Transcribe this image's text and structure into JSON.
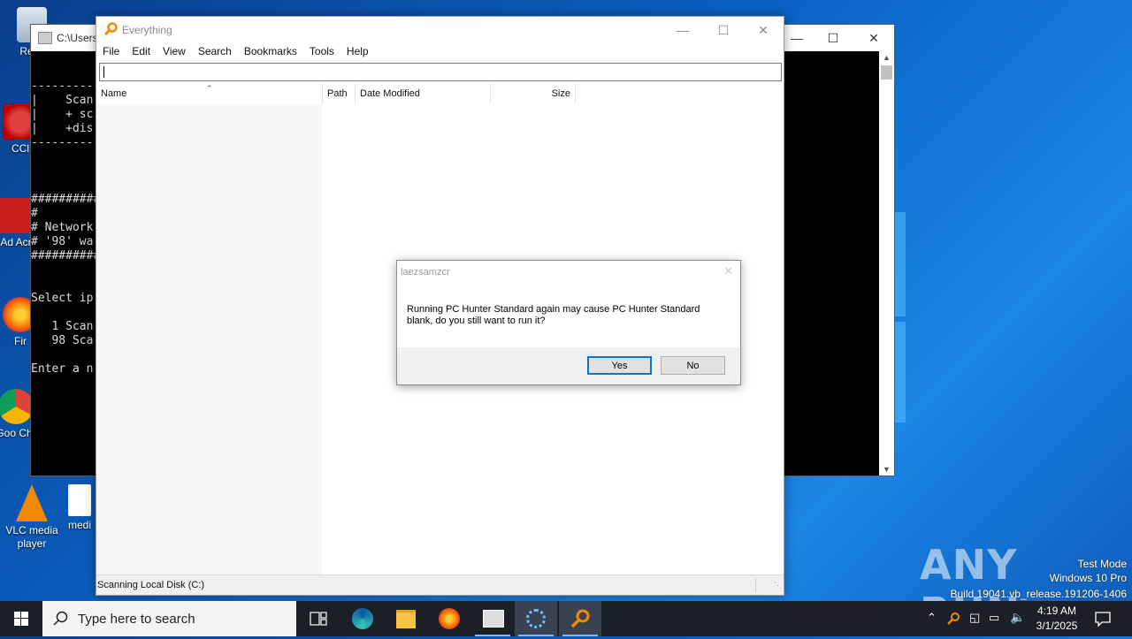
{
  "desktop": {
    "icons": [
      {
        "label": "Recy"
      },
      {
        "label": "CCl"
      },
      {
        "label": "Ad Acr"
      },
      {
        "label": "Fir"
      },
      {
        "label": "Goo Chr"
      },
      {
        "label": "VLC media player"
      },
      {
        "label": "medi"
      }
    ]
  },
  "console": {
    "title": "C:\\Users",
    "lines": [
      "",
      "",
      "----------",
      "|    Scan",
      "|    + sc",
      "|    +dis",
      "----------",
      "",
      "",
      "",
      "##########",
      "#",
      "# Network",
      "# '98' wa",
      "##########",
      "",
      "",
      "Select ip",
      "",
      "   1 Scan",
      "   98 Sca",
      "",
      "Enter a n"
    ]
  },
  "everything": {
    "title": "Everything",
    "menu": [
      "File",
      "Edit",
      "View",
      "Search",
      "Bookmarks",
      "Tools",
      "Help"
    ],
    "search_value": "",
    "columns": [
      "Name",
      "Path",
      "Date Modified",
      "Size"
    ],
    "status": "Scanning Local Disk (C:)"
  },
  "dialog": {
    "title": "laezsamzcr",
    "message": "Running PC Hunter Standard again may cause PC Hunter Standard blank, do you still want to run it?",
    "yes": "Yes",
    "no": "No"
  },
  "watermark": {
    "brand": "ANY RUN",
    "line1": "Test Mode",
    "line2": "Windows 10 Pro",
    "line3": "Build 19041.vb_release.191206-1406"
  },
  "taskbar": {
    "search_placeholder": "Type here to search",
    "time": "4:19 AM",
    "date": "3/1/2025"
  },
  "colors": {
    "desktop_blue": "#0b62c4",
    "accent": "#0078d7",
    "taskbar": "#1b1f26"
  }
}
